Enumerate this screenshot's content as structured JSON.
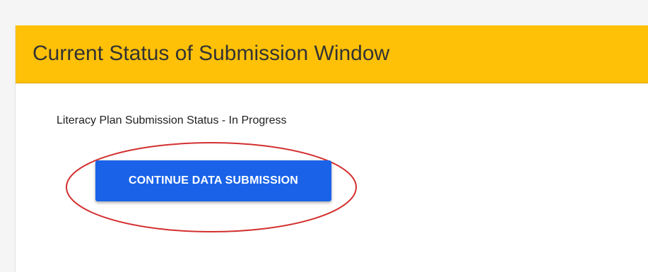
{
  "card": {
    "title": "Current Status of Submission Window",
    "status_text": "Literacy Plan Submission Status - In Progress",
    "button_label": "CONTINUE DATA SUBMISSION"
  },
  "colors": {
    "header": "#ffc107",
    "button": "#1a63e8",
    "annotation": "#d32f2f"
  }
}
